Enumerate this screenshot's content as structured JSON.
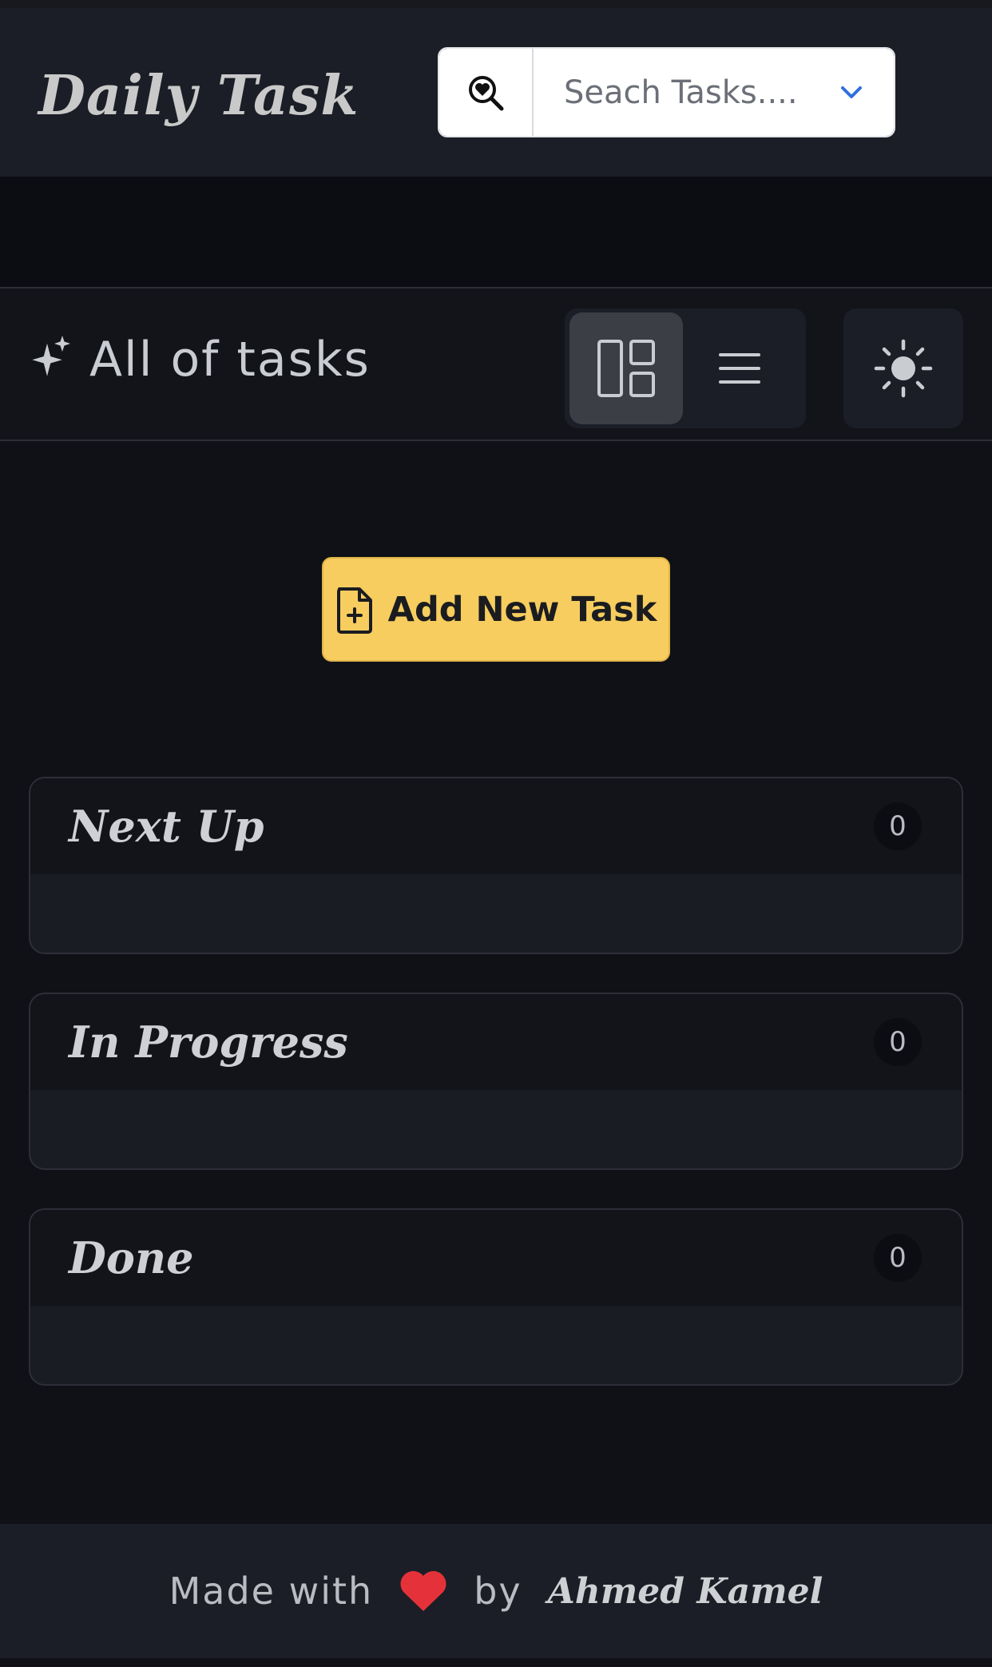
{
  "app": {
    "title": "Daily Task"
  },
  "search": {
    "placeholder": "Seach Tasks....",
    "icon": "search-heart-icon",
    "dropdown_icon": "chevron-down-icon"
  },
  "toolbar": {
    "title": "All of tasks",
    "view_modes": [
      "grid",
      "list"
    ],
    "active_view": "grid",
    "theme_icon": "sun-icon"
  },
  "actions": {
    "add_label": "Add New Task"
  },
  "columns": [
    {
      "title": "Next Up",
      "count": "0"
    },
    {
      "title": "In Progress",
      "count": "0"
    },
    {
      "title": "Done",
      "count": "0"
    }
  ],
  "footer": {
    "made_with": "Made with",
    "by": "by",
    "author": "Ahmed Kamel"
  },
  "colors": {
    "accent": "#f6cd5e",
    "heart": "#e5323a",
    "background": "#0f1116",
    "header": "#1b1e26"
  }
}
